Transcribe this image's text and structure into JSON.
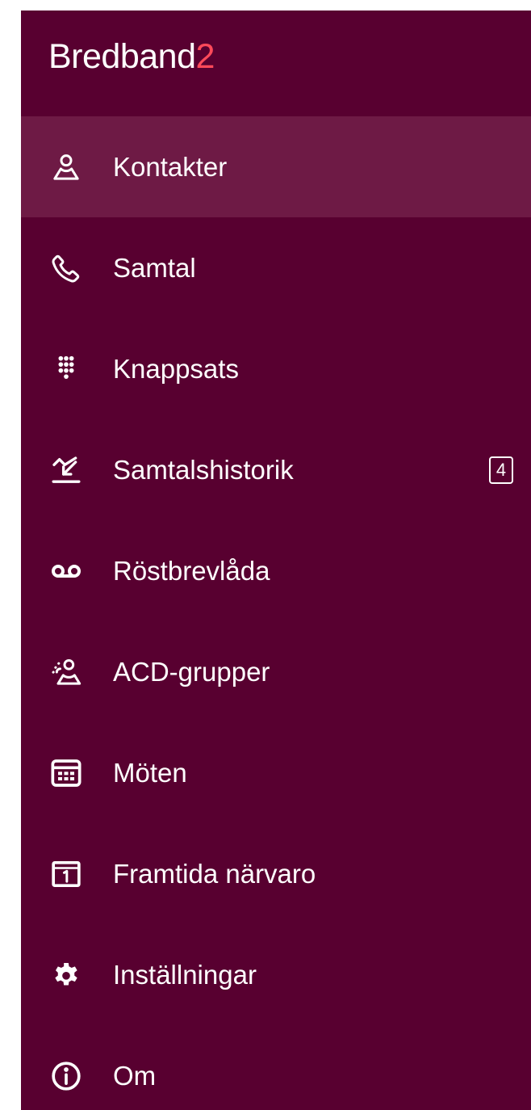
{
  "brand": {
    "name": "Bredband",
    "suffix": "2",
    "colors": {
      "background": "#580030",
      "active_item": "#6e1a45",
      "accent": "#ff4a5a",
      "text": "#ffffff"
    }
  },
  "menu": {
    "active": "Kontakter",
    "items": [
      {
        "label": "Kontakter",
        "icon": "person-icon"
      },
      {
        "label": "Samtal",
        "icon": "phone-icon"
      },
      {
        "label": "Knappsats",
        "icon": "dialpad-icon"
      },
      {
        "label": "Samtalshistorik",
        "icon": "call-history-icon",
        "badge": "4"
      },
      {
        "label": "Röstbrevlåda",
        "icon": "voicemail-icon"
      },
      {
        "label": "ACD-grupper",
        "icon": "group-icon"
      },
      {
        "label": "Möten",
        "icon": "meetings-icon"
      },
      {
        "label": "Framtida närvaro",
        "icon": "calendar-icon"
      },
      {
        "label": "Inställningar",
        "icon": "gear-icon"
      },
      {
        "label": "Om",
        "icon": "info-icon"
      }
    ]
  }
}
